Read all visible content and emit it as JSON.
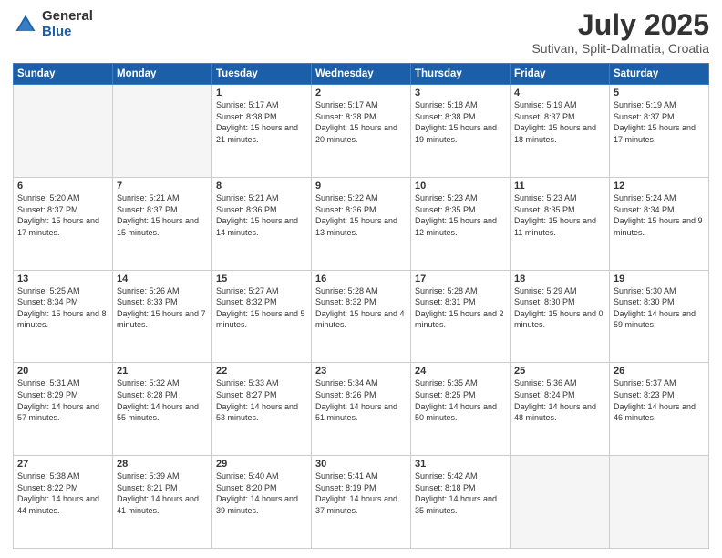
{
  "header": {
    "logo_general": "General",
    "logo_blue": "Blue",
    "title": "July 2025",
    "subtitle": "Sutivan, Split-Dalmatia, Croatia"
  },
  "weekdays": [
    "Sunday",
    "Monday",
    "Tuesday",
    "Wednesday",
    "Thursday",
    "Friday",
    "Saturday"
  ],
  "weeks": [
    [
      {
        "day": "",
        "info": ""
      },
      {
        "day": "",
        "info": ""
      },
      {
        "day": "1",
        "info": "Sunrise: 5:17 AM\nSunset: 8:38 PM\nDaylight: 15 hours and 21 minutes."
      },
      {
        "day": "2",
        "info": "Sunrise: 5:17 AM\nSunset: 8:38 PM\nDaylight: 15 hours and 20 minutes."
      },
      {
        "day": "3",
        "info": "Sunrise: 5:18 AM\nSunset: 8:38 PM\nDaylight: 15 hours and 19 minutes."
      },
      {
        "day": "4",
        "info": "Sunrise: 5:19 AM\nSunset: 8:37 PM\nDaylight: 15 hours and 18 minutes."
      },
      {
        "day": "5",
        "info": "Sunrise: 5:19 AM\nSunset: 8:37 PM\nDaylight: 15 hours and 17 minutes."
      }
    ],
    [
      {
        "day": "6",
        "info": "Sunrise: 5:20 AM\nSunset: 8:37 PM\nDaylight: 15 hours and 17 minutes."
      },
      {
        "day": "7",
        "info": "Sunrise: 5:21 AM\nSunset: 8:37 PM\nDaylight: 15 hours and 15 minutes."
      },
      {
        "day": "8",
        "info": "Sunrise: 5:21 AM\nSunset: 8:36 PM\nDaylight: 15 hours and 14 minutes."
      },
      {
        "day": "9",
        "info": "Sunrise: 5:22 AM\nSunset: 8:36 PM\nDaylight: 15 hours and 13 minutes."
      },
      {
        "day": "10",
        "info": "Sunrise: 5:23 AM\nSunset: 8:35 PM\nDaylight: 15 hours and 12 minutes."
      },
      {
        "day": "11",
        "info": "Sunrise: 5:23 AM\nSunset: 8:35 PM\nDaylight: 15 hours and 11 minutes."
      },
      {
        "day": "12",
        "info": "Sunrise: 5:24 AM\nSunset: 8:34 PM\nDaylight: 15 hours and 9 minutes."
      }
    ],
    [
      {
        "day": "13",
        "info": "Sunrise: 5:25 AM\nSunset: 8:34 PM\nDaylight: 15 hours and 8 minutes."
      },
      {
        "day": "14",
        "info": "Sunrise: 5:26 AM\nSunset: 8:33 PM\nDaylight: 15 hours and 7 minutes."
      },
      {
        "day": "15",
        "info": "Sunrise: 5:27 AM\nSunset: 8:32 PM\nDaylight: 15 hours and 5 minutes."
      },
      {
        "day": "16",
        "info": "Sunrise: 5:28 AM\nSunset: 8:32 PM\nDaylight: 15 hours and 4 minutes."
      },
      {
        "day": "17",
        "info": "Sunrise: 5:28 AM\nSunset: 8:31 PM\nDaylight: 15 hours and 2 minutes."
      },
      {
        "day": "18",
        "info": "Sunrise: 5:29 AM\nSunset: 8:30 PM\nDaylight: 15 hours and 0 minutes."
      },
      {
        "day": "19",
        "info": "Sunrise: 5:30 AM\nSunset: 8:30 PM\nDaylight: 14 hours and 59 minutes."
      }
    ],
    [
      {
        "day": "20",
        "info": "Sunrise: 5:31 AM\nSunset: 8:29 PM\nDaylight: 14 hours and 57 minutes."
      },
      {
        "day": "21",
        "info": "Sunrise: 5:32 AM\nSunset: 8:28 PM\nDaylight: 14 hours and 55 minutes."
      },
      {
        "day": "22",
        "info": "Sunrise: 5:33 AM\nSunset: 8:27 PM\nDaylight: 14 hours and 53 minutes."
      },
      {
        "day": "23",
        "info": "Sunrise: 5:34 AM\nSunset: 8:26 PM\nDaylight: 14 hours and 51 minutes."
      },
      {
        "day": "24",
        "info": "Sunrise: 5:35 AM\nSunset: 8:25 PM\nDaylight: 14 hours and 50 minutes."
      },
      {
        "day": "25",
        "info": "Sunrise: 5:36 AM\nSunset: 8:24 PM\nDaylight: 14 hours and 48 minutes."
      },
      {
        "day": "26",
        "info": "Sunrise: 5:37 AM\nSunset: 8:23 PM\nDaylight: 14 hours and 46 minutes."
      }
    ],
    [
      {
        "day": "27",
        "info": "Sunrise: 5:38 AM\nSunset: 8:22 PM\nDaylight: 14 hours and 44 minutes."
      },
      {
        "day": "28",
        "info": "Sunrise: 5:39 AM\nSunset: 8:21 PM\nDaylight: 14 hours and 41 minutes."
      },
      {
        "day": "29",
        "info": "Sunrise: 5:40 AM\nSunset: 8:20 PM\nDaylight: 14 hours and 39 minutes."
      },
      {
        "day": "30",
        "info": "Sunrise: 5:41 AM\nSunset: 8:19 PM\nDaylight: 14 hours and 37 minutes."
      },
      {
        "day": "31",
        "info": "Sunrise: 5:42 AM\nSunset: 8:18 PM\nDaylight: 14 hours and 35 minutes."
      },
      {
        "day": "",
        "info": ""
      },
      {
        "day": "",
        "info": ""
      }
    ]
  ]
}
